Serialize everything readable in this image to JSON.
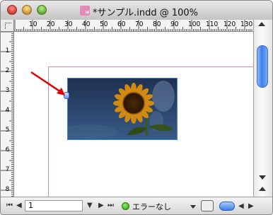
{
  "window": {
    "title": "*サンプル.indd @ 100%",
    "doc_icon_badge": "id",
    "traffic_lights": [
      "close-icon",
      "minimize-icon",
      "zoom-icon"
    ]
  },
  "rulers": {
    "horizontal_labels": [
      "10",
      "20",
      "30",
      "40",
      "50",
      "60",
      "70",
      "80",
      "90",
      "100",
      "110",
      "120",
      "130"
    ],
    "vertical_labels": [
      "1",
      "2",
      "3",
      "4",
      "5",
      "6",
      "7",
      "8"
    ]
  },
  "image_frame": {
    "content": "sunflower photo",
    "accent_color": "#4a7fd4"
  },
  "annotation": {
    "arrow_color": "#e00000"
  },
  "statusbar": {
    "first_page_symbol": "⏮",
    "prev_page_symbol": "◀",
    "page_number": "1",
    "next_page_symbol": "▶",
    "last_page_symbol": "⏭",
    "page_menu_symbol": "▼",
    "preflight_status": "エラーなし",
    "preflight_status_color": "#2a9a10"
  }
}
